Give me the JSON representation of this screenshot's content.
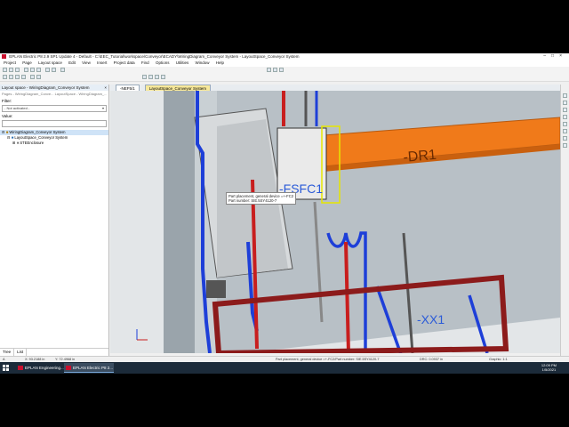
{
  "window": {
    "title": "EPLAN Electric P8 2.9 SP1 Update 4 - Default - C:\\EEC_Tutorial\\workspace\\Conveyor\\ECADY\\WiringDiagram_Conveyor System - LayoutSpace_Conveyor System",
    "controls": [
      "–",
      "□",
      "×"
    ]
  },
  "menu": {
    "items": [
      "Project",
      "Page",
      "Layout space",
      "Edit",
      "View",
      "Insert",
      "Project data",
      "Find",
      "Options",
      "Utilities",
      "Window",
      "Help"
    ]
  },
  "left_panel": {
    "title": "Layout space - WiringDiagram_Conveyor System",
    "path": "Pages - WiringDiagram_Conve... LayoutSpace - WiringDiagram_...",
    "filter_label": "Filter:",
    "filter_value": "- Not activated -",
    "value_label": "Value:",
    "tree": [
      "WiringDiagram_Conveyor System",
      "LayoutSpace_Conveyor System",
      "STEEnclosure"
    ],
    "tabs": [
      "Tree",
      "List"
    ]
  },
  "doc_tabs": [
    "-NEF5/1",
    "LayoutSpace_Conveyor System"
  ],
  "viewport": {
    "label_dr1": "-DR1",
    "label_fc1": "-FSFC1",
    "label_xx1": "-XX1",
    "tooltip_line1": "Part placement, general device =+-FC2",
    "tooltip_line2": "Part number: SIE.5SY4120-7"
  },
  "status": {
    "mode": "A",
    "coord_x": "X: 93.2188 in",
    "coord_y": "Y: 72.4968 in",
    "selection": "Part placement, general device =+-FC2/Part number: SIE.5SY4120-7",
    "drc": "DRC: 0.0937 in",
    "graphic": "Graphic: 1:1"
  },
  "taskbar": {
    "apps": [
      "EPLAN Engineering...",
      "EPLAN Electric P8 2..."
    ],
    "time": "12:09 PM",
    "date": "1/5/2021"
  },
  "colors": {
    "brand_red": "#c8102e",
    "duct_orange": "#f07a1a",
    "wire_blue": "#1e3fd8",
    "wire_red": "#c81e1e"
  }
}
